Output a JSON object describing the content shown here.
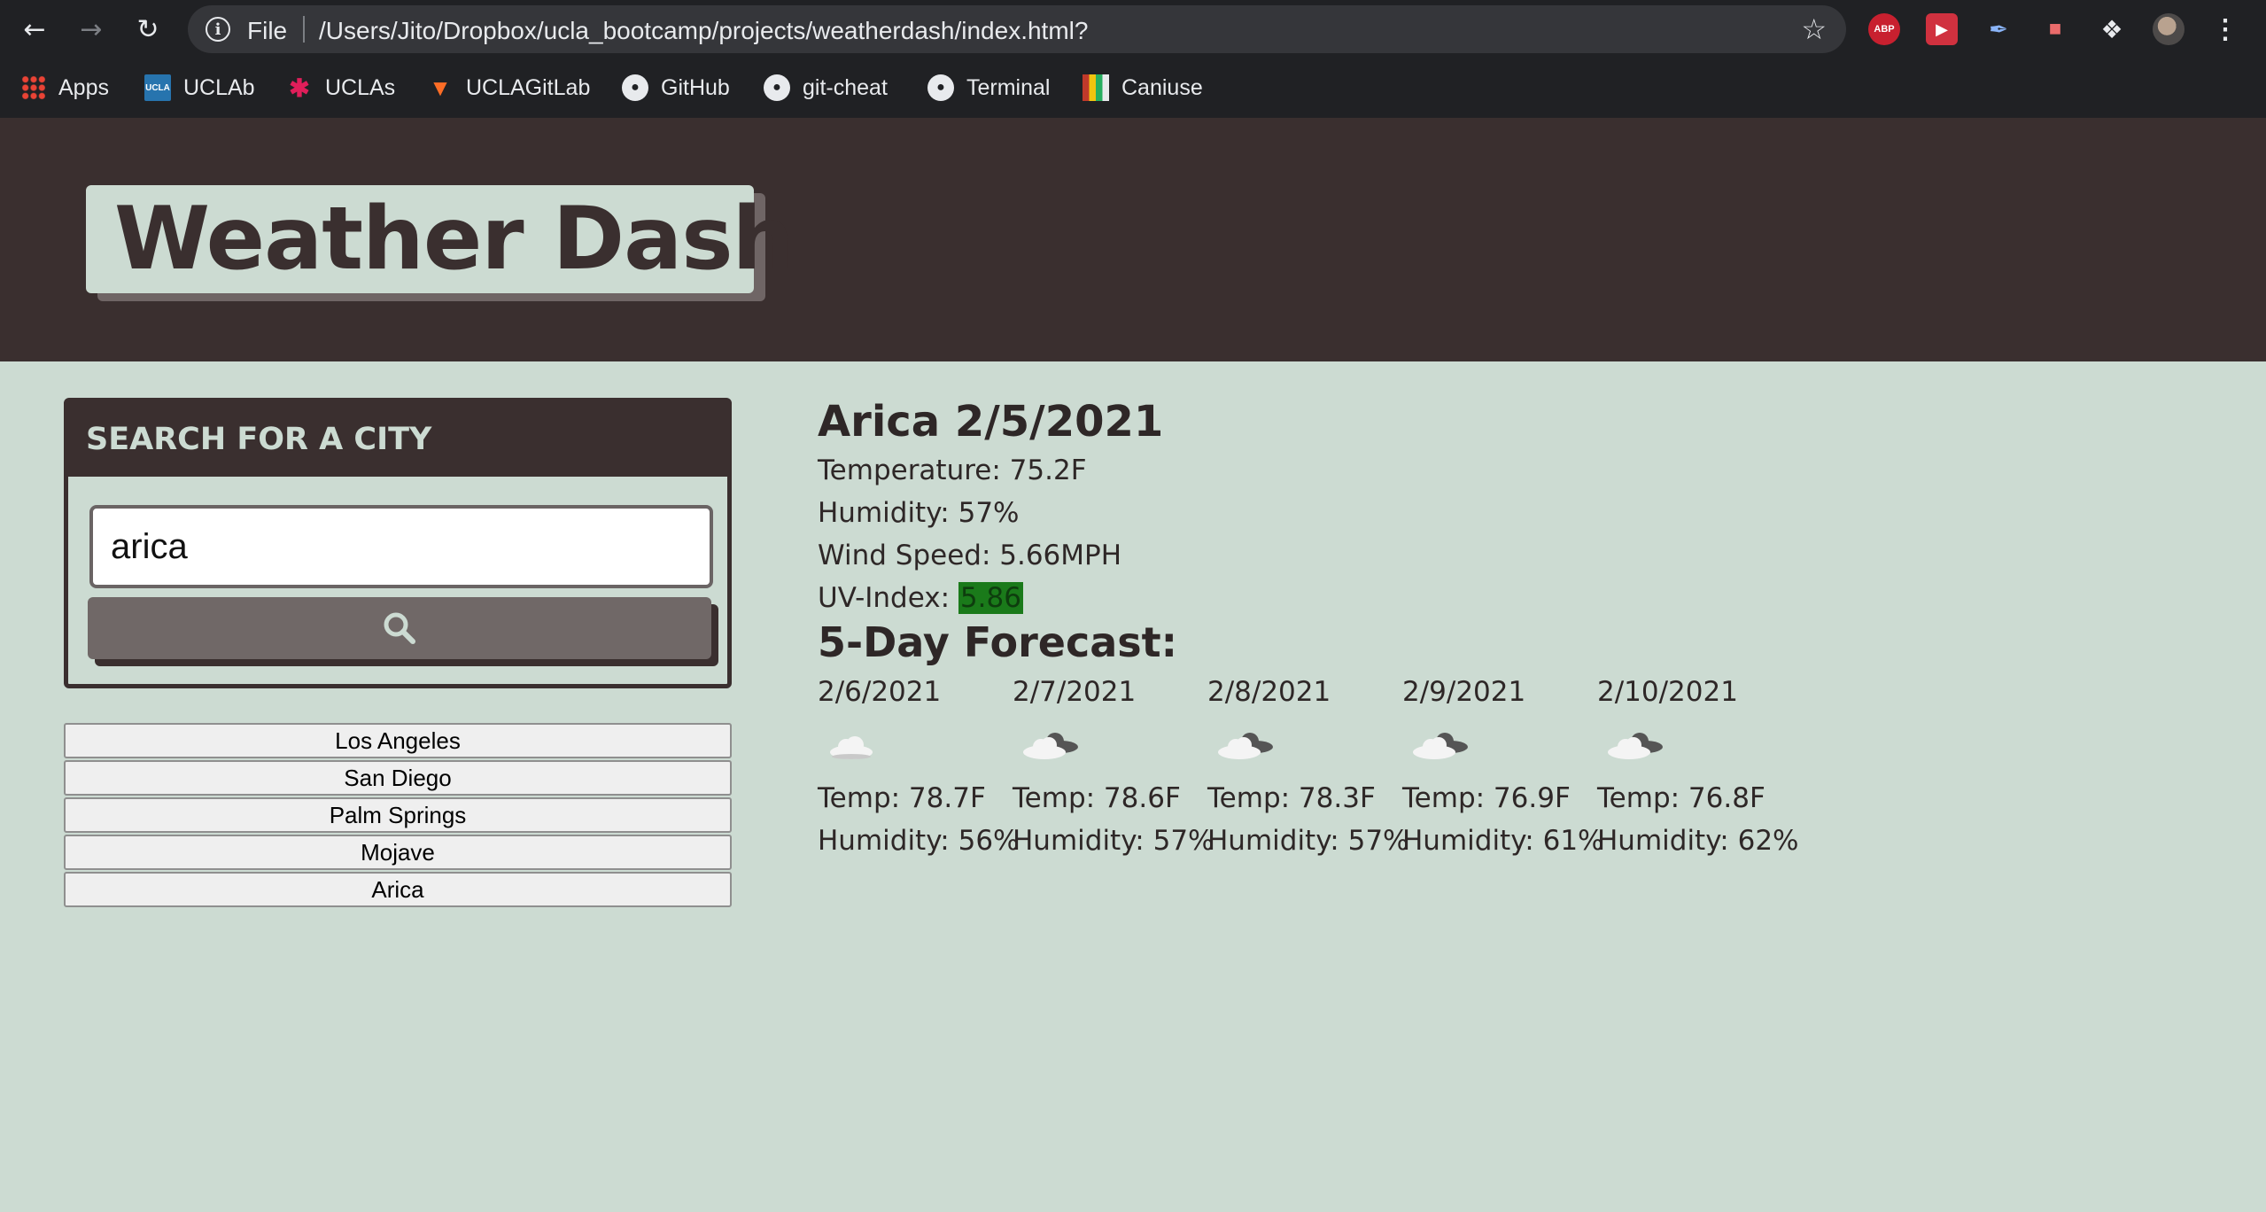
{
  "browser": {
    "omnibox": {
      "scheme_label": "File",
      "url": "/Users/Jito/Dropbox/ucla_bootcamp/projects/weatherdash/index.html?"
    },
    "extensions": {
      "abp_label": "ABP"
    },
    "bookmarks": [
      {
        "label": "Apps",
        "icon": "apps-grid-icon"
      },
      {
        "label": "UCLAb",
        "icon": "ucla-icon"
      },
      {
        "label": "UCLAs",
        "icon": "slack-icon"
      },
      {
        "label": "UCLAGitLab",
        "icon": "gitlab-icon"
      },
      {
        "label": "GitHub",
        "icon": "github-icon"
      },
      {
        "label": "git-cheat",
        "icon": "github-icon"
      },
      {
        "label": "Terminal",
        "icon": "github-icon"
      },
      {
        "label": "Caniuse",
        "icon": "caniuse-icon"
      }
    ],
    "ucla_icon_text": "UCLA"
  },
  "header": {
    "title": "Weather Dash",
    "icon": "thermometer-icon"
  },
  "search": {
    "heading": "SEARCH FOR A CITY",
    "input_value": "arica",
    "button_icon": "search-icon"
  },
  "history": [
    "Los Angeles",
    "San Diego",
    "Palm Springs",
    "Mojave",
    "Arica"
  ],
  "current": {
    "city_date": "Arica 2/5/2021",
    "temperature": "Temperature: 75.2F",
    "humidity": "Humidity: 57%",
    "wind": "Wind Speed: 5.66MPH",
    "uv_label": "UV-Index: ",
    "uv_value": "5.86",
    "uv_color": "#1a7a1a"
  },
  "forecast": {
    "title": "5-Day Forecast:",
    "days": [
      {
        "date": "2/6/2021",
        "icon": "cloud-icon",
        "temp": "Temp: 78.7F",
        "humidity": "Humidity: 56%"
      },
      {
        "date": "2/7/2021",
        "icon": "broken-clouds-icon",
        "temp": "Temp: 78.6F",
        "humidity": "Humidity: 57%"
      },
      {
        "date": "2/8/2021",
        "icon": "broken-clouds-icon",
        "temp": "Temp: 78.3F",
        "humidity": "Humidity: 57%"
      },
      {
        "date": "2/9/2021",
        "icon": "broken-clouds-icon",
        "temp": "Temp: 76.9F",
        "humidity": "Humidity: 61%"
      },
      {
        "date": "2/10/2021",
        "icon": "broken-clouds-icon",
        "temp": "Temp: 76.8F",
        "humidity": "Humidity: 62%"
      }
    ]
  },
  "colors": {
    "header_bg": "#3a2f2f",
    "page_bg": "#ccdbd2",
    "button_bg": "#706867"
  }
}
